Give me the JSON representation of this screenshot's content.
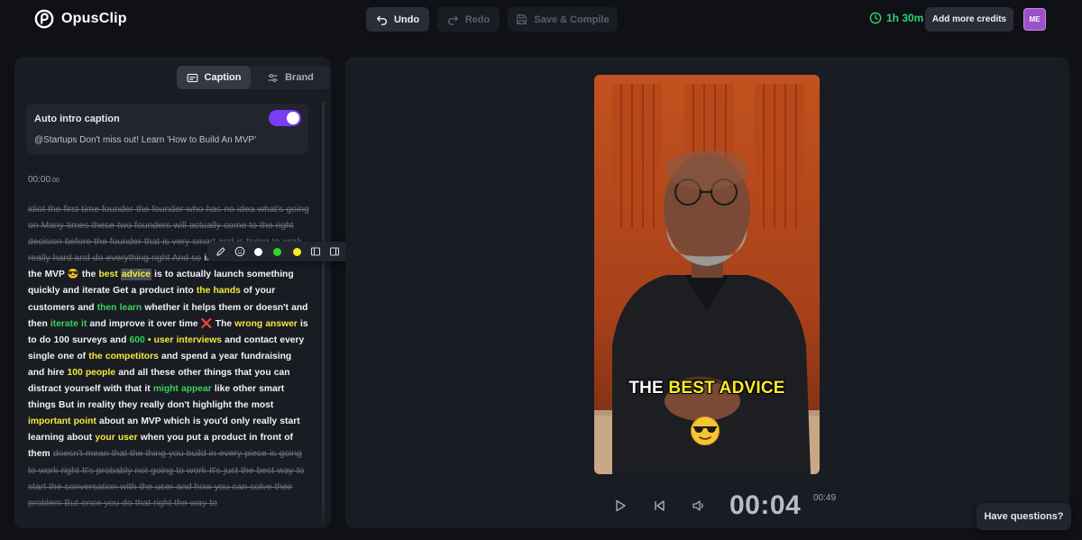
{
  "app": {
    "name": "OpusClip"
  },
  "toolbar": {
    "undo_label": "Undo",
    "redo_label": "Redo",
    "compile_label": "Save & Compile",
    "time_left": "1h 30m",
    "credits_label": "Add more credits",
    "avatar_initials": "ME"
  },
  "sidebar": {
    "tabs": [
      {
        "label": "Caption",
        "icon": "caption-icon",
        "active": true
      },
      {
        "label": "Brand",
        "icon": "sliders-icon",
        "active": false
      }
    ],
    "intro": {
      "title": "Auto intro caption",
      "enabled": true,
      "text": "@Startups Don't miss out! Learn 'How to Build An MVP'"
    },
    "timestamp_main": "00:00",
    "timestamp_ms": ".00",
    "transcript": [
      {
        "text": "idiot the first time founder the founder who has no idea what's going on Many times these two founders will actually come to the right decision before the founder that is very smart and is trying to work really hard and do everything right And so",
        "style": "struck"
      },
      {
        "text": " in this situation with the MVP ",
        "style": "plain"
      },
      {
        "text": "😎",
        "style": "plain"
      },
      {
        "text": " the ",
        "style": "plain"
      },
      {
        "text": "best",
        "style": "yellow"
      },
      {
        "text": " ",
        "style": "plain"
      },
      {
        "text": "advice",
        "style": "selected"
      },
      {
        "text": " is to actually launch something quickly and iterate Get a product into ",
        "style": "plain"
      },
      {
        "text": "the hands",
        "style": "yellow"
      },
      {
        "text": " of your customers and ",
        "style": "plain"
      },
      {
        "text": "then learn",
        "style": "green"
      },
      {
        "text": " whether it helps them or doesn't and then ",
        "style": "plain"
      },
      {
        "text": "iterate it",
        "style": "green"
      },
      {
        "text": " and improve it over time ",
        "style": "plain"
      },
      {
        "text": "❌",
        "style": "plain"
      },
      {
        "text": " The ",
        "style": "plain"
      },
      {
        "text": "wrong answer",
        "style": "yellow"
      },
      {
        "text": " is to do 100 surveys and ",
        "style": "plain"
      },
      {
        "text": "600",
        "style": "green"
      },
      {
        "text": " • ",
        "style": "yellow"
      },
      {
        "text": "user interviews",
        "style": "yellow"
      },
      {
        "text": " and contact every single one of ",
        "style": "plain"
      },
      {
        "text": "the competitors",
        "style": "yellow"
      },
      {
        "text": " and spend a year fundraising and hire ",
        "style": "plain"
      },
      {
        "text": "100 people",
        "style": "yellow"
      },
      {
        "text": " and all these other things that you can distract yourself with that it ",
        "style": "plain"
      },
      {
        "text": "might appear",
        "style": "green"
      },
      {
        "text": " like other smart things But in reality they really don't highlight the most ",
        "style": "plain"
      },
      {
        "text": "important point",
        "style": "yellow"
      },
      {
        "text": " about an MVP which is you'd only really start learning about ",
        "style": "plain"
      },
      {
        "text": "your user",
        "style": "yellow"
      },
      {
        "text": " when you put a product in front of them ",
        "style": "plain"
      },
      {
        "text": "doesn't mean that the thing you build in every piece is going to work right It's probably not going to work It's just the best way to start the conversation with the user and how you can solve their problem But once you do that right the way to",
        "style": "struck"
      }
    ]
  },
  "editor_toolbar": {
    "items": [
      {
        "name": "edit-icon",
        "type": "icon"
      },
      {
        "name": "emoji-add-icon",
        "type": "icon"
      },
      {
        "name": "color-white",
        "type": "color",
        "color": "#ffffff"
      },
      {
        "name": "color-green",
        "type": "color",
        "color": "#2fd42f"
      },
      {
        "name": "color-yellow",
        "type": "color",
        "color": "#f5ea1a"
      },
      {
        "name": "layout-left-icon",
        "type": "icon"
      },
      {
        "name": "layout-right-icon",
        "type": "icon"
      },
      {
        "name": "trash-icon",
        "type": "icon"
      }
    ]
  },
  "player": {
    "caption_words": [
      {
        "text": "THE",
        "highlight": false
      },
      {
        "text": "BEST ADVICE",
        "highlight": true
      }
    ],
    "caption_emoji": "😎",
    "current_time": "00:04",
    "duration": "00:49"
  },
  "help": {
    "label": "Have questions?"
  },
  "colors": {
    "accent": "#7a3cf6",
    "highlight_yellow": "#f5e93a",
    "highlight_green": "#35d45a",
    "timer_green": "#34d16b"
  }
}
